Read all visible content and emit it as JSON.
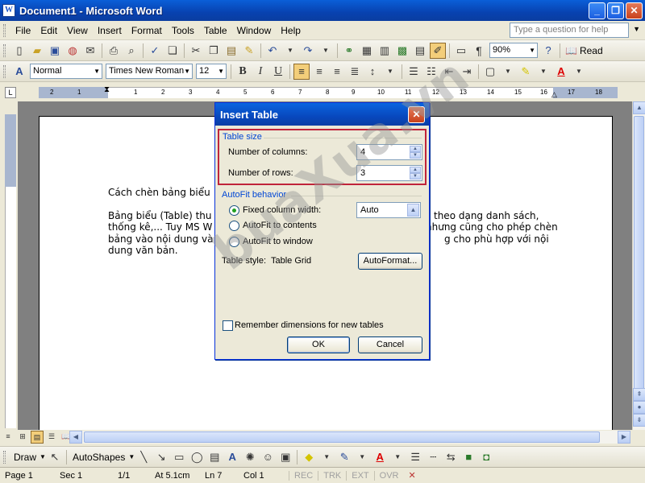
{
  "window": {
    "title": "Document1 - Microsoft Word",
    "icon_letter": "W",
    "minimize": "_",
    "restore": "❐",
    "close": "✕"
  },
  "menu": {
    "items": [
      "File",
      "Edit",
      "View",
      "Insert",
      "Format",
      "Tools",
      "Table",
      "Window",
      "Help"
    ],
    "ask_placeholder": "Type a question for help",
    "close_doc": "✕"
  },
  "standard_toolbar": {
    "zoom": "90%",
    "read_label": "Read"
  },
  "formatting_toolbar": {
    "style": "Normal",
    "font": "Times New Roman",
    "size": "12"
  },
  "ruler": {
    "labels": [
      "2",
      "1",
      "1",
      "2",
      "3",
      "4",
      "5",
      "6",
      "7",
      "8",
      "9",
      "10",
      "11",
      "12",
      "13",
      "14",
      "15",
      "16",
      "17",
      "18"
    ],
    "tab_selector": "L"
  },
  "document": {
    "heading": "Cách chèn bảng biểu",
    "para_line1_left": "Bảng biểu (Table) thu",
    "para_line1_right": "theo dạng danh sách,",
    "para_line2_left": "thống kê,... Tuy MS W",
    "para_line2_right": "nhưng cũng cho phép chèn",
    "para_line3_left": "bảng vào nội dung và",
    "para_line3_right": "g cho phù hợp với nội",
    "para_line4": "dung văn bản."
  },
  "dialog": {
    "title": "Insert Table",
    "table_size_label": "Table size",
    "columns_label": "Number of columns:",
    "columns_value": "4",
    "rows_label": "Number of rows:",
    "rows_value": "3",
    "autofit_label": "AutoFit behavior",
    "fixed_width_label": "Fixed column width:",
    "fixed_width_value": "Auto",
    "autofit_contents_label": "AutoFit to contents",
    "autofit_window_label": "AutoFit to window",
    "table_style_label": "Table style:",
    "table_style_value": "Table Grid",
    "autoformat_button": "AutoFormat...",
    "remember_label": "Remember dimensions for new tables",
    "ok_button": "OK",
    "cancel_button": "Cancel"
  },
  "drawing_toolbar": {
    "draw_label": "Draw",
    "autoshapes_label": "AutoShapes"
  },
  "status": {
    "page": "Page 1",
    "sec": "Sec 1",
    "of": "1/1",
    "at": "At 5.1cm",
    "ln": "Ln 7",
    "col": "Col 1",
    "rec": "REC",
    "trk": "TRK",
    "ext": "EXT",
    "ovr": "OVR"
  },
  "watermark": "buaXua.vn",
  "colors": {
    "title_blue": "#0842b0",
    "highlight_red": "#c0243a",
    "group_label_blue": "#0046d5"
  }
}
